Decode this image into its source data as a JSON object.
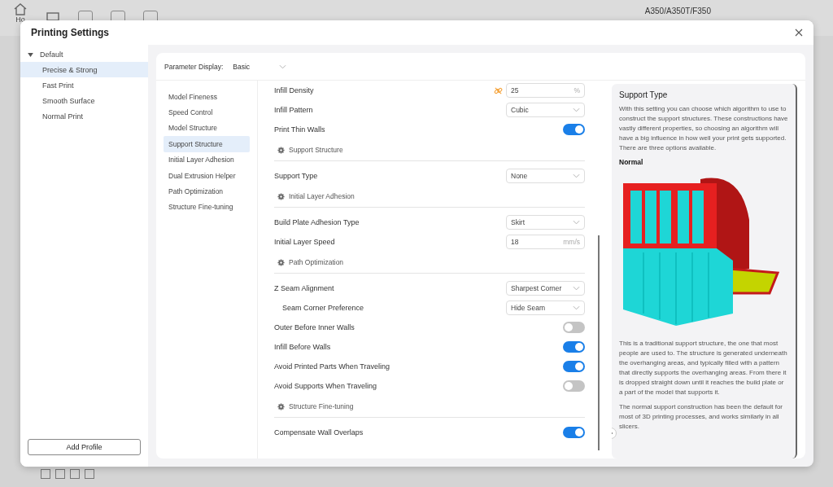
{
  "background": {
    "home_label": "Ho",
    "printer": "A350/A350T/F350"
  },
  "dialog": {
    "title": "Printing Settings"
  },
  "profiles": {
    "group": "Default",
    "expanded": true,
    "items": [
      {
        "label": "Precise & Strong",
        "selected": true
      },
      {
        "label": "Fast Print",
        "selected": false
      },
      {
        "label": "Smooth Surface",
        "selected": false
      },
      {
        "label": "Normal Print",
        "selected": false
      }
    ],
    "add_button": "Add Profile"
  },
  "parameter_display": {
    "label": "Parameter Display:",
    "value": "Basic"
  },
  "categories": [
    {
      "label": "Model Fineness",
      "selected": false
    },
    {
      "label": "Speed Control",
      "selected": false
    },
    {
      "label": "Model Structure",
      "selected": false
    },
    {
      "label": "Support Structure",
      "selected": true
    },
    {
      "label": "Initial Layer Adhesion",
      "selected": false
    },
    {
      "label": "Dual Extrusion Helper",
      "selected": false
    },
    {
      "label": "Path Optimization",
      "selected": false
    },
    {
      "label": "Structure Fine-tuning",
      "selected": false
    }
  ],
  "settings": [
    {
      "kind": "input",
      "label": "Infill Density",
      "value": "25",
      "unit": "%",
      "linked": true
    },
    {
      "kind": "select",
      "label": "Infill Pattern",
      "value": "Cubic"
    },
    {
      "kind": "toggle",
      "label": "Print Thin Walls",
      "on": true
    },
    {
      "kind": "section",
      "label": "Support Structure"
    },
    {
      "kind": "select",
      "label": "Support Type",
      "value": "None"
    },
    {
      "kind": "section",
      "label": "Initial Layer Adhesion"
    },
    {
      "kind": "select",
      "label": "Build Plate Adhesion Type",
      "value": "Skirt"
    },
    {
      "kind": "input",
      "label": "Initial Layer Speed",
      "value": "18",
      "unit": "mm/s",
      "linked": false
    },
    {
      "kind": "section",
      "label": "Path Optimization"
    },
    {
      "kind": "select",
      "label": "Z Seam Alignment",
      "value": "Sharpest Corner",
      "children": [
        {
          "kind": "select",
          "label": "Seam Corner Preference",
          "value": "Hide Seam"
        }
      ]
    },
    {
      "kind": "toggle",
      "label": "Outer Before Inner Walls",
      "on": false
    },
    {
      "kind": "toggle",
      "label": "Infill Before Walls",
      "on": true
    },
    {
      "kind": "toggle",
      "label": "Avoid Printed Parts When Traveling",
      "on": true
    },
    {
      "kind": "toggle",
      "label": "Avoid Supports When Traveling",
      "on": false
    },
    {
      "kind": "section",
      "label": "Structure Fine-tuning"
    },
    {
      "kind": "toggle",
      "label": "Compensate Wall Overlaps",
      "on": true
    }
  ],
  "help": {
    "title": "Support Type",
    "intro": "With this setting you can choose which algorithm to use to construct the support structures. These constructions have vastly different properties, so choosing an algorithm will have a big influence in how well your print gets supported. There are three options available.",
    "subtitle": "Normal",
    "paragraphs": [
      "This is a traditional support structure, the one that most people are used to. The structure is generated underneath the overhanging areas, and typically filled with a pattern that directly supports the overhanging areas. From there it is dropped straight down until it reaches the build plate or a part of the model that supports it.",
      "The normal support construction has been the default for most of 3D printing processes, and works similarly in all slicers."
    ]
  }
}
